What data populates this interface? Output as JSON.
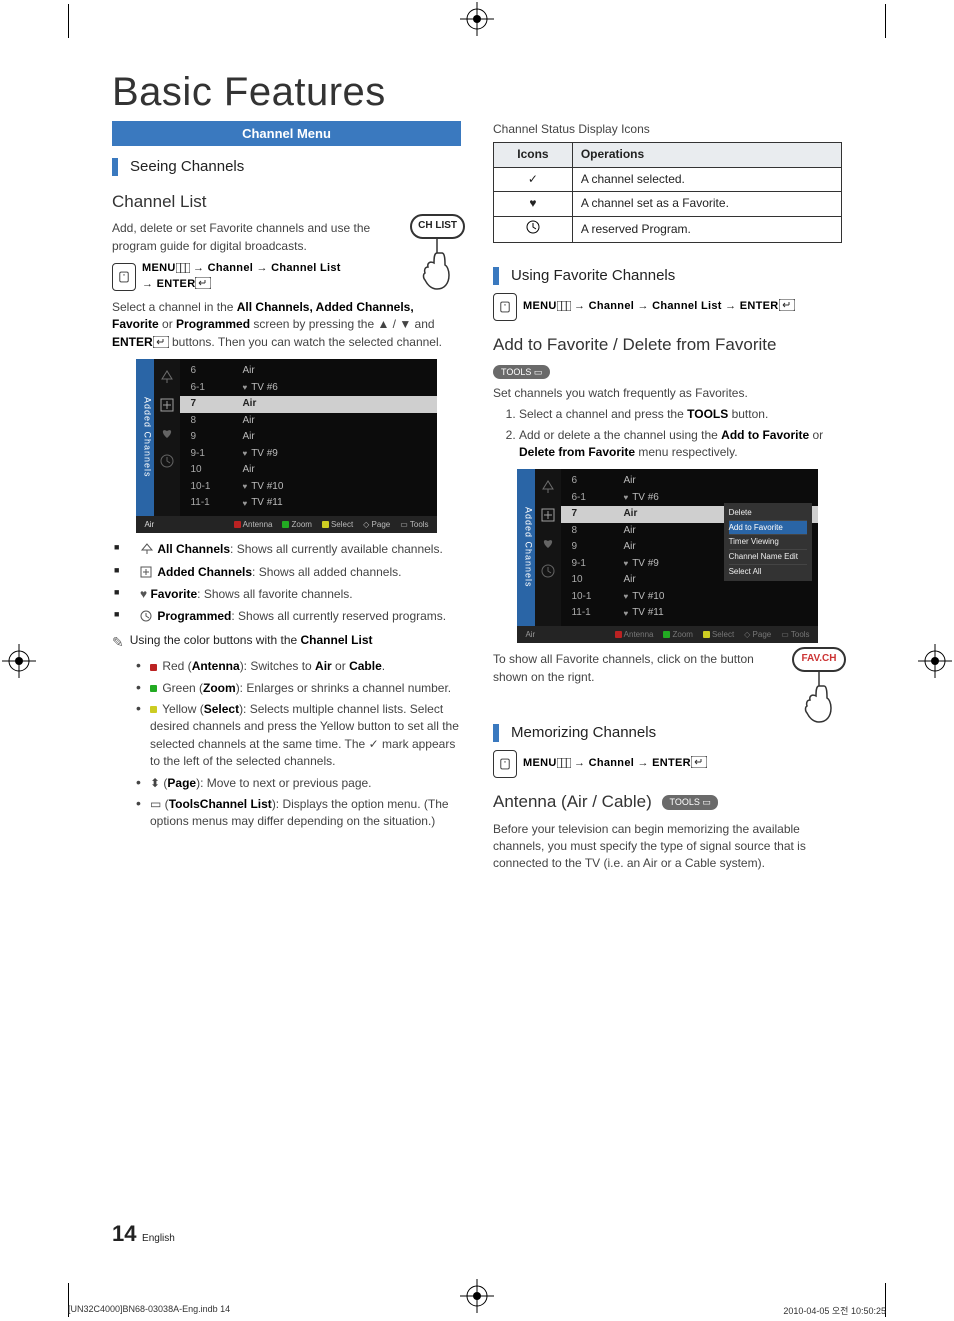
{
  "title": "Basic Features",
  "tabBar": "Channel Menu",
  "footer": {
    "pageNum": "14",
    "lang": "English",
    "file": "[UN32C4000]BN68-03038A-Eng.indb   14",
    "ts": "2010-04-05   오전 10:50:25"
  },
  "left": {
    "h2_seeing": "Seeing Channels",
    "h3_chlist": "Channel List",
    "p1": "Add, delete or set Favorite channels and use the program guide for digital broadcasts.",
    "menuPath": {
      "menu": "MENU",
      "path1": "Channel",
      "path2": "Channel List",
      "enter": "ENTER"
    },
    "hand1_label": "CH LIST",
    "p2a": "Select a channel in the ",
    "p2b": "All Channels, Added Channels, Favorite",
    "p2c": " or ",
    "p2d": "Programmed",
    "p2e": " screen by pressing the ▲ / ▼ and ",
    "p2enter": "ENTER",
    "p2f": " buttons. Then you can watch the selected channel.",
    "tv": {
      "side": "Added Channels",
      "rows": [
        {
          "num": "6",
          "name": "Air",
          "fav": false,
          "hi": false
        },
        {
          "num": "6-1",
          "name": "TV #6",
          "fav": true,
          "hi": false
        },
        {
          "num": "7",
          "name": "Air",
          "fav": false,
          "hi": true
        },
        {
          "num": "8",
          "name": "Air",
          "fav": false,
          "hi": false
        },
        {
          "num": "9",
          "name": "Air",
          "fav": false,
          "hi": false
        },
        {
          "num": "9-1",
          "name": "TV #9",
          "fav": true,
          "hi": false
        },
        {
          "num": "10",
          "name": "Air",
          "fav": false,
          "hi": false
        },
        {
          "num": "10-1",
          "name": "TV #10",
          "fav": true,
          "hi": false
        },
        {
          "num": "11-1",
          "name": "TV #11",
          "fav": true,
          "hi": false
        }
      ],
      "antLabel": "Air",
      "foot": {
        "antenna": "Antenna",
        "zoom": "Zoom",
        "select": "Select",
        "page": "Page",
        "tools": "Tools"
      }
    },
    "bullets": [
      {
        "b": "All Channels",
        "t": ": Shows all currently available channels."
      },
      {
        "b": "Added Channels",
        "t": ": Shows all added channels."
      },
      {
        "b": "Favorite",
        "t": ": Shows all favorite channels."
      },
      {
        "b": "Programmed",
        "t": ": Shows all currently reserved programs."
      }
    ],
    "note_a": "Using the color buttons with the ",
    "note_b": "Channel List",
    "color": [
      {
        "lead": "Red (",
        "b": "Antenna",
        "t": "): Switches to ",
        "b2": "Air",
        "mid": " or ",
        "b3": "Cable",
        "end": "."
      },
      {
        "lead": "Green (",
        "b": "Zoom",
        "t": "): Enlarges or shrinks a channel number."
      },
      {
        "lead": "Yellow (",
        "b": "Select",
        "t": "): Selects multiple channel lists. Select desired channels and press the Yellow button to set all the selected channels at the same time. The ✓ mark appears to the left of the selected channels."
      },
      {
        "lead": "",
        "b": "",
        "t": " (",
        "b2": "Page",
        "end": "): Move to next or previous page.",
        "glyph": "arrows"
      },
      {
        "lead": "",
        "b": "",
        "t": " (",
        "b2": "Tools",
        "end": "): Displays the ",
        "b3": "Channel List",
        "tail": " option menu. (The options menus may differ depending on the situation.)",
        "glyph": "tools"
      }
    ]
  },
  "right": {
    "iconsTitle": "Channel Status Display Icons",
    "table": {
      "h1": "Icons",
      "h2": "Operations",
      "rows": [
        {
          "icon": "check",
          "op": "A channel selected."
        },
        {
          "icon": "heart",
          "op": "A channel set as a Favorite."
        },
        {
          "icon": "clock",
          "op": "A reserved Program."
        }
      ]
    },
    "h2_fav": "Using Favorite Channels",
    "menuPath": {
      "menu": "MENU",
      "path1": "Channel",
      "path2": "Channel List",
      "enter": "ENTER"
    },
    "h3_addfav": "Add to Favorite / Delete from Favorite",
    "tools": "TOOLS",
    "p_setfav": "Set channels you watch frequently as Favorites.",
    "step1": "Select a channel and press the ",
    "step1b": "TOOLS",
    "step1c": " button.",
    "step2a": "Add or delete a the channel using the ",
    "step2b": "Add to Favorite",
    "step2c": " or ",
    "step2d": "Delete from Favorite",
    "step2e": " menu respectively.",
    "tv": {
      "side": "Added Channels",
      "rows": [
        {
          "num": "6",
          "name": "Air",
          "fav": false,
          "hi": false
        },
        {
          "num": "6-1",
          "name": "TV #6",
          "fav": true,
          "hi": false
        },
        {
          "num": "7",
          "name": "Air",
          "fav": false,
          "hi": true
        },
        {
          "num": "8",
          "name": "Air",
          "fav": false,
          "hi": false
        },
        {
          "num": "9",
          "name": "Air",
          "fav": false,
          "hi": false
        },
        {
          "num": "9-1",
          "name": "TV #9",
          "fav": true,
          "hi": false
        },
        {
          "num": "10",
          "name": "Air",
          "fav": false,
          "hi": false
        },
        {
          "num": "10-1",
          "name": "TV #10",
          "fav": true,
          "hi": false
        },
        {
          "num": "11-1",
          "name": "TV #11",
          "fav": true,
          "hi": false
        }
      ],
      "antLabel": "Air",
      "ctx": [
        "Delete",
        "Add to Favorite",
        "Timer Viewing",
        "Channel Name Edit",
        "Select All"
      ],
      "foot": {
        "antenna": "Antenna",
        "zoom": "Zoom",
        "select": "Select",
        "page": "Page",
        "tools": "Tools"
      }
    },
    "hand2_label": "FAV.CH",
    "p_showfav": "To show all Favorite channels, click on the button shown on the rignt.",
    "h2_mem": "Memorizing Channels",
    "menuPath2": {
      "menu": "MENU",
      "path1": "Channel",
      "enter": "ENTER"
    },
    "h3_ant": "Antenna (Air / Cable)",
    "p_ant": "Before your television can begin memorizing the available channels, you must specify the type of signal source that is connected to the TV (i.e. an Air or a Cable system)."
  }
}
